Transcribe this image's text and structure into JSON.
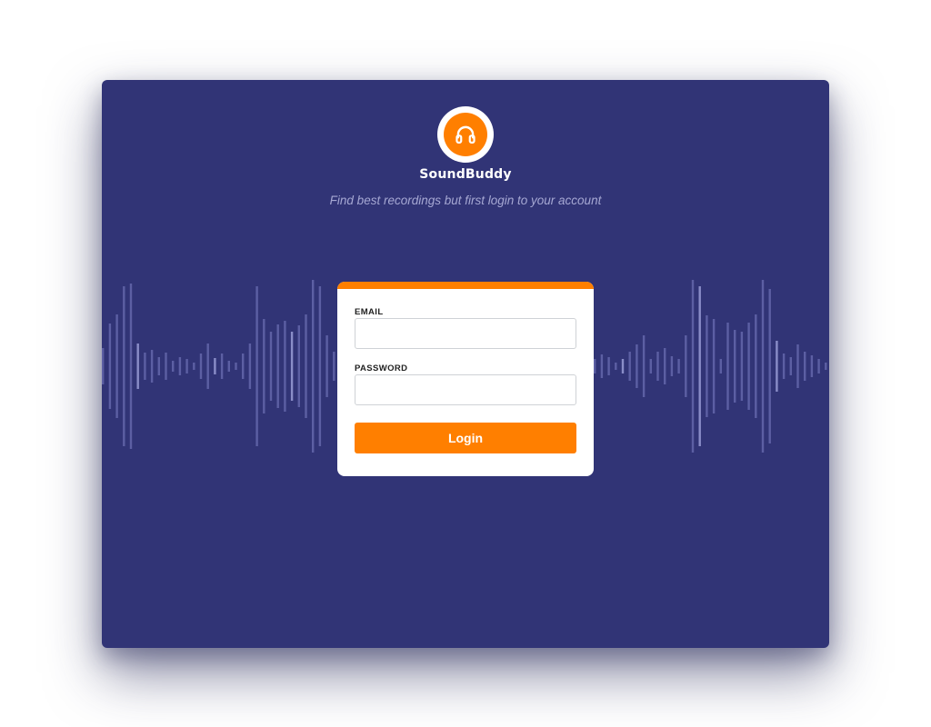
{
  "app": {
    "name": "SoundBuddy",
    "tagline": "Find best recordings but first login to your account",
    "logo_icon": "headphones-icon"
  },
  "colors": {
    "background": "#313476",
    "accent": "#ff7f00",
    "card": "#ffffff",
    "waveform": "#5a5d9c"
  },
  "login_form": {
    "email_label": "EMAIL",
    "email_value": "",
    "email_placeholder": "",
    "password_label": "PASSWORD",
    "password_value": "",
    "password_placeholder": "",
    "submit_label": "Login"
  }
}
